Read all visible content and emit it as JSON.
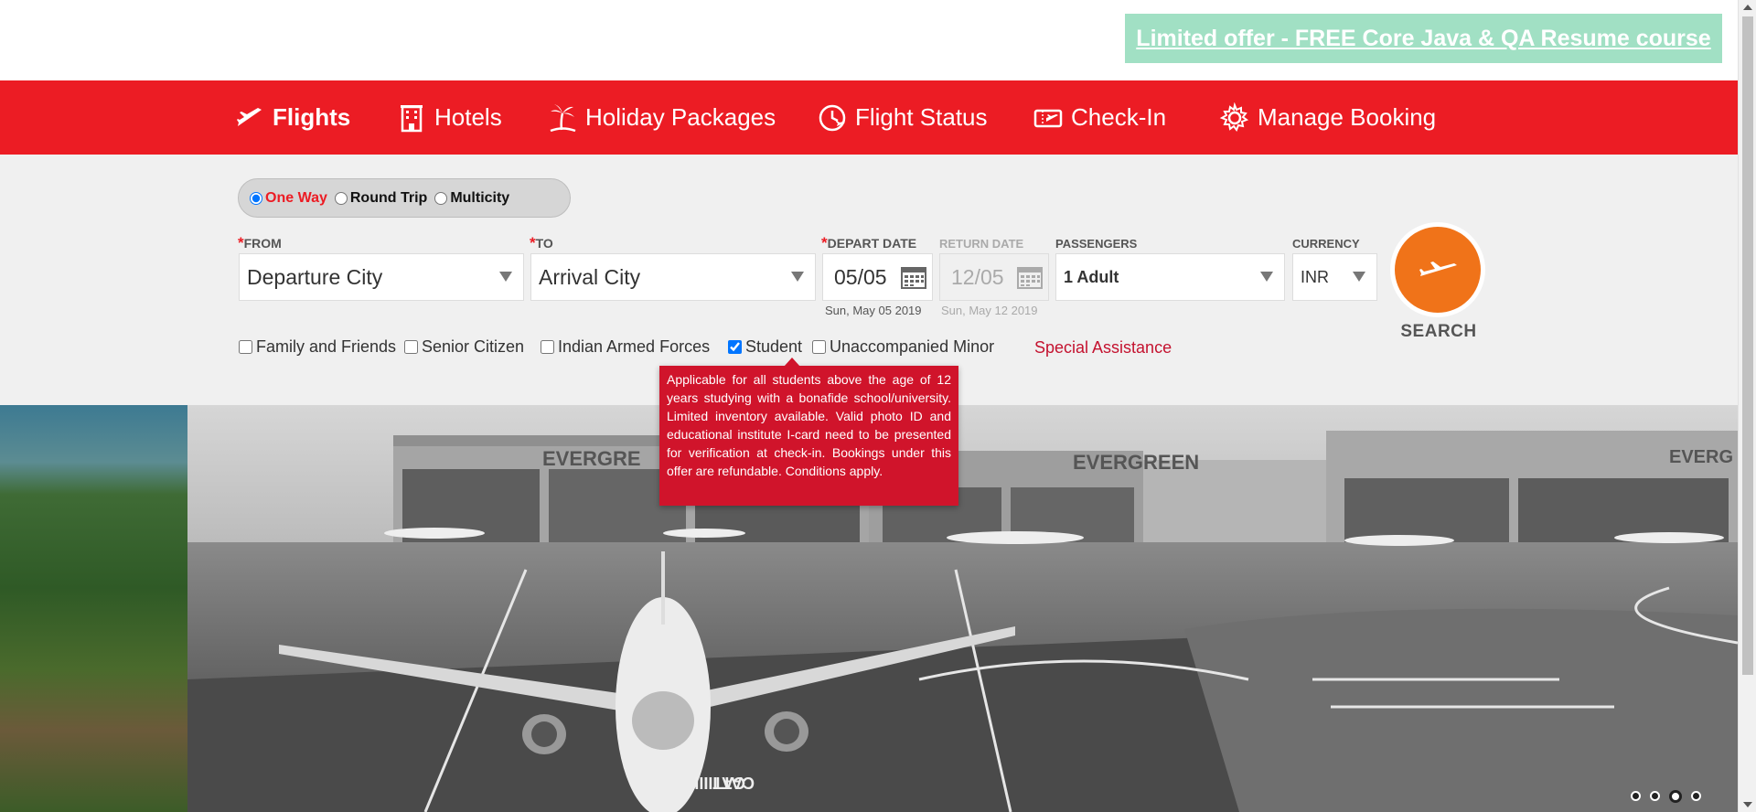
{
  "promo": {
    "text": "Limited offer - FREE Core Java & QA Resume course"
  },
  "nav": {
    "items": [
      {
        "label": "Flights",
        "icon": "plane-icon"
      },
      {
        "label": "Hotels",
        "icon": "hotel-icon"
      },
      {
        "label": "Holiday Packages",
        "icon": "palm-tree-icon"
      },
      {
        "label": "Flight Status",
        "icon": "flight-status-icon"
      },
      {
        "label": "Check-In",
        "icon": "ticket-icon"
      },
      {
        "label": "Manage Booking",
        "icon": "gear-icon"
      }
    ]
  },
  "trip": {
    "one_way": "One Way",
    "round_trip": "Round Trip",
    "multicity": "Multicity"
  },
  "form": {
    "from_label": "FROM",
    "from_value": "Departure City",
    "to_label": "TO",
    "to_value": "Arrival City",
    "depart_label": "DEPART DATE",
    "depart_value": "05/05",
    "depart_sub": "Sun, May 05 2019",
    "return_label": "RETURN DATE",
    "return_value": "12/05",
    "return_sub": "Sun, May 12 2019",
    "passengers_label": "PASSENGERS",
    "passengers_value": "1 Adult",
    "currency_label": "CURRENCY",
    "currency_value": "INR",
    "required_mark": "*"
  },
  "search": {
    "label": "SEARCH"
  },
  "options": {
    "family": "Family and Friends",
    "senior": "Senior Citizen",
    "armed": "Indian Armed Forces",
    "student": "Student",
    "minor": "Unaccompanied Minor",
    "special": "Special Assistance"
  },
  "tooltip": {
    "text": "Applicable for all students above the age of 12 years studying with a bonafide school/university. Limited inventory available. Valid photo ID and educational institute I-card need to be presented for verification at check-in. Bookings under this offer are refundable. Conditions apply."
  },
  "hero": {
    "sign_left": "EVERGRE",
    "sign_center": "EVERGREEN",
    "sign_right": "EVERG",
    "runway_text": "CAT III"
  },
  "colors": {
    "brand_red": "#ec1c24",
    "search_orange": "#f07319",
    "promo_green": "#a1e0c4",
    "panel_gray": "#f0f0f0"
  }
}
